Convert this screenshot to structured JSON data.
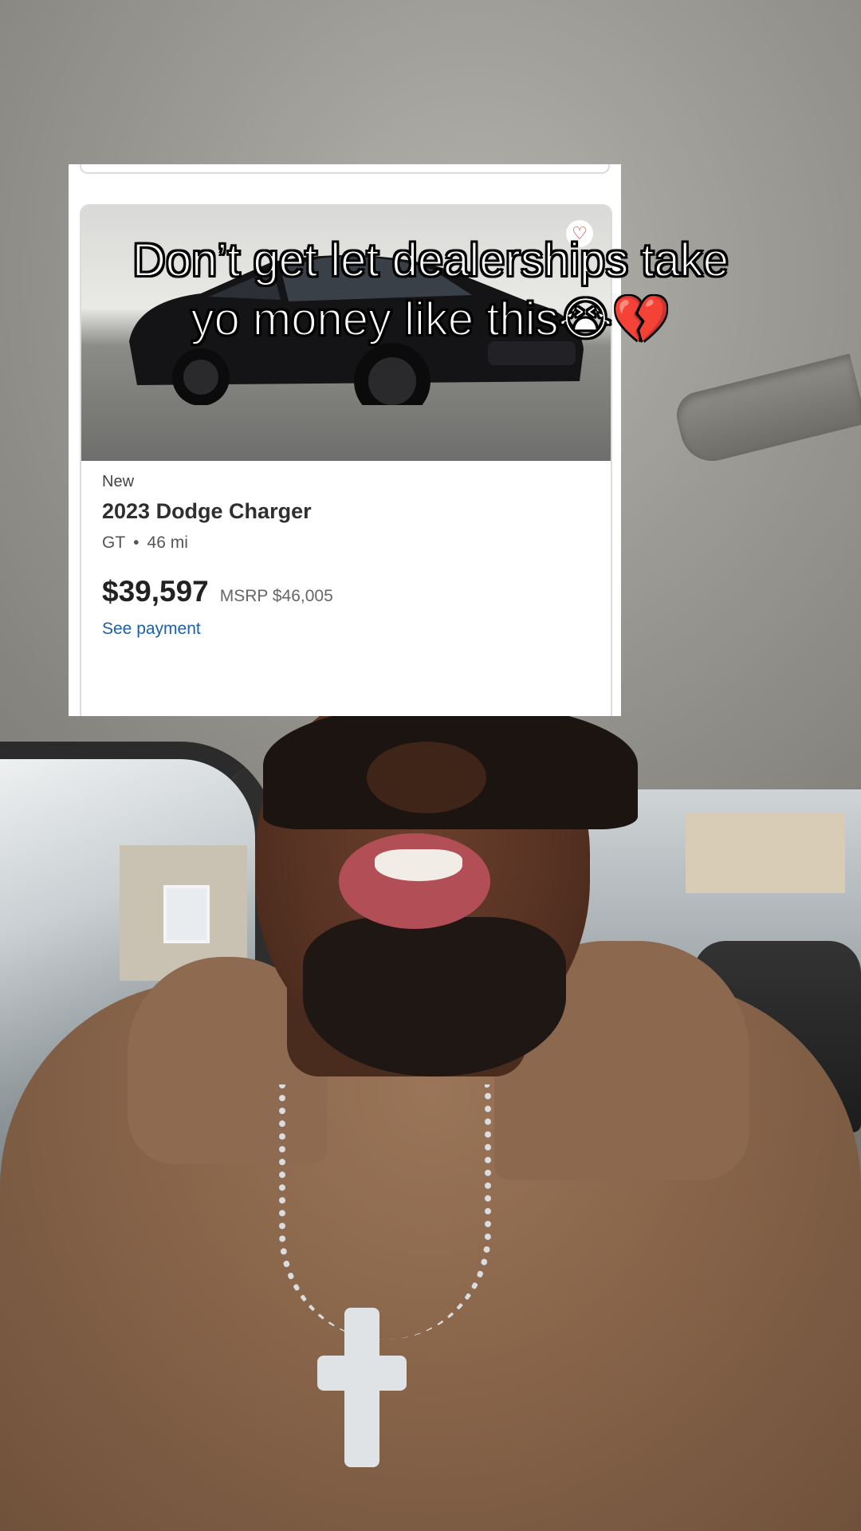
{
  "caption": {
    "line1": "Don’t get let dealerships take",
    "line2": "yo money like this😭💔"
  },
  "listing": {
    "condition": "New",
    "title": "2023 Dodge Charger",
    "trim": "GT",
    "separator": "•",
    "mileage": "46 mi",
    "price": "$39,597",
    "msrp": "MSRP $46,005",
    "payment_link": "See payment",
    "favorite_icon": "heart-icon"
  },
  "colors": {
    "link": "#1a5fa8",
    "hoodie": "#8a664b",
    "card_bg": "#ffffff"
  }
}
